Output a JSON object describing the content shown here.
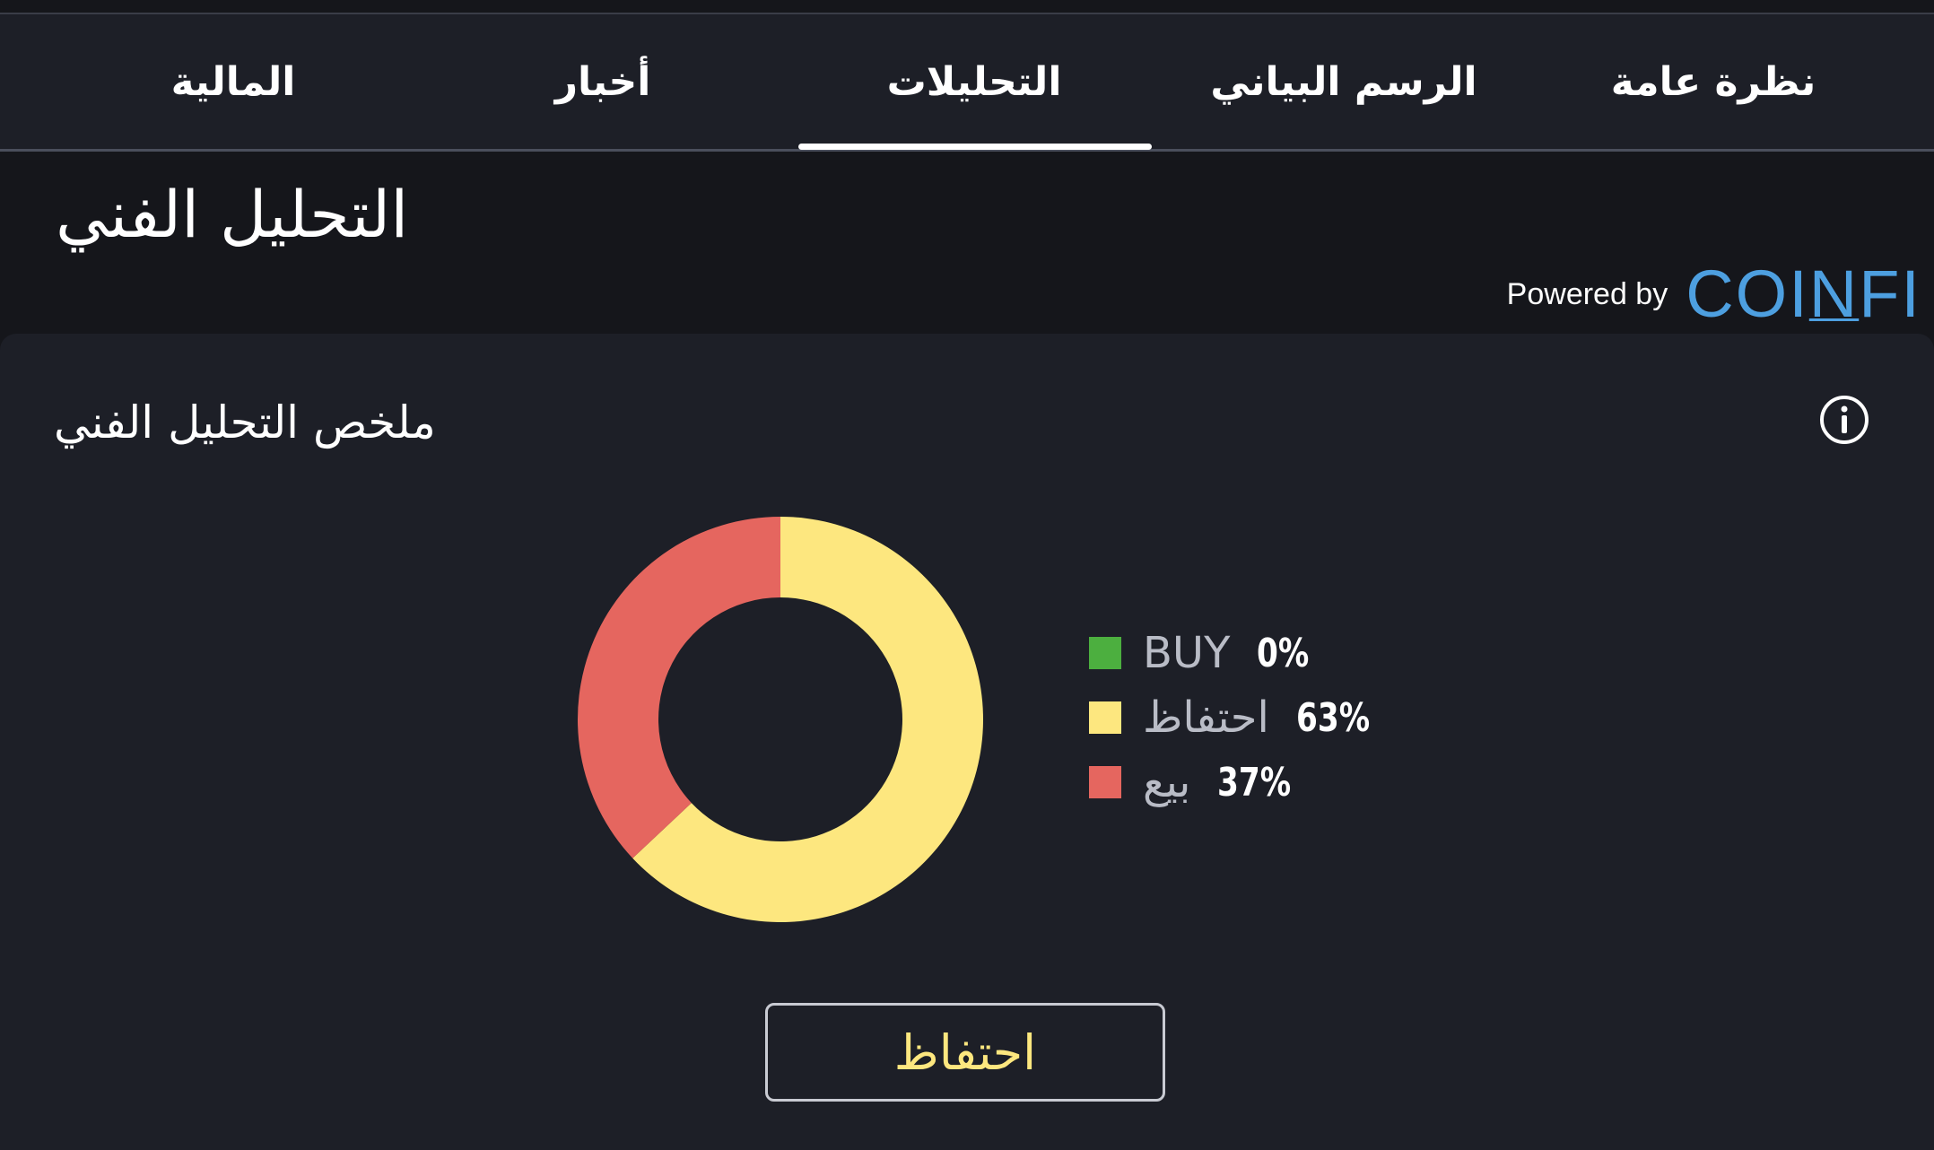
{
  "tabs": [
    {
      "label": "المالية"
    },
    {
      "label": "أخبار"
    },
    {
      "label": "التحليلات"
    },
    {
      "label": "الرسم البياني"
    },
    {
      "label": "نظرة عامة"
    }
  ],
  "active_tab": "التحليلات",
  "page_title": "التحليل الفني",
  "powered_by": {
    "label": "Powered by",
    "brand": "COINFI"
  },
  "summary": {
    "title": "ملخص التحليل الفني",
    "info_icon": "info-circle-icon",
    "verdict_button": "احتفاظ"
  },
  "colors": {
    "background": "#15161b",
    "panel": "#1d1f27",
    "buy": "#4caf3f",
    "hold": "#fde77f",
    "sell": "#e5665f",
    "brand": "#4d9fe0"
  },
  "chart_data": {
    "type": "pie",
    "categories": [
      "BUY",
      "احتفاظ",
      "بيع"
    ],
    "values": [
      0,
      63,
      37
    ],
    "value_labels": [
      "0%",
      "63%",
      "37%"
    ],
    "colors": [
      "#4caf3f",
      "#fde77f",
      "#e5665f"
    ],
    "legend_position": "right"
  }
}
